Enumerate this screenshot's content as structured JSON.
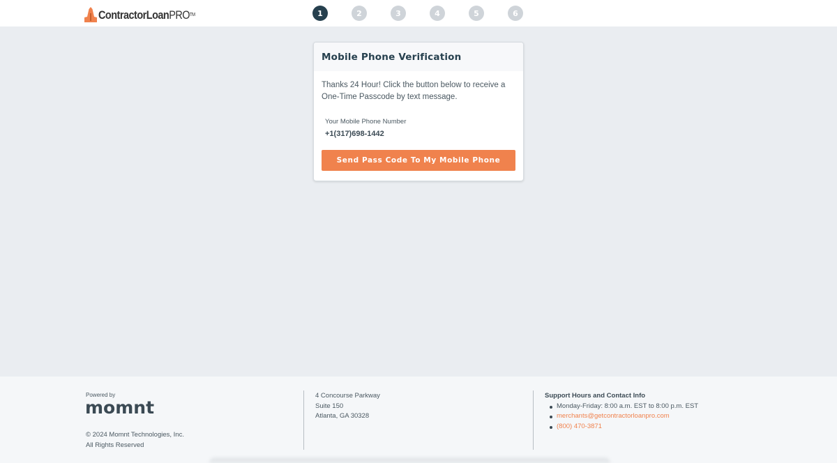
{
  "header": {
    "logo": {
      "brand_main": "ContractorLoan",
      "brand_pro": "PRO",
      "brand_tm": "TM"
    },
    "steps": [
      "1",
      "2",
      "3",
      "4",
      "5",
      "6"
    ],
    "active_step": 1
  },
  "card": {
    "title": "Mobile Phone Verification",
    "intro": "Thanks 24 Hour! Click the button below to receive a One-Time Passcode by text message.",
    "phone_label": "Your Mobile Phone Number",
    "phone_value": "+1(317)698-1442",
    "send_button_label": "Send Pass Code To My Mobile Phone"
  },
  "footer": {
    "powered_by": "Powered by",
    "momnt_logo": "momnt",
    "copyright": "© 2024 Momnt Technologies, Inc.",
    "rights": "All Rights Reserved",
    "address": [
      "4 Concourse Parkway",
      "Suite 150",
      "Atlanta, GA 30328"
    ],
    "support_title": "Support Hours and Contact Info",
    "support_hours": "Monday-Friday: 8:00 a.m. EST to 8:00 p.m. EST",
    "support_email": "merchants@getcontractorloanpro.com",
    "support_phone": "(800) 470-3871"
  },
  "colors": {
    "accent": "#f0824d",
    "active_step": "#26404e",
    "inactive_step": "#cfd4d9",
    "page_background": "#eaedf1"
  },
  "icons": {
    "logo": "hard-hat-icon"
  }
}
